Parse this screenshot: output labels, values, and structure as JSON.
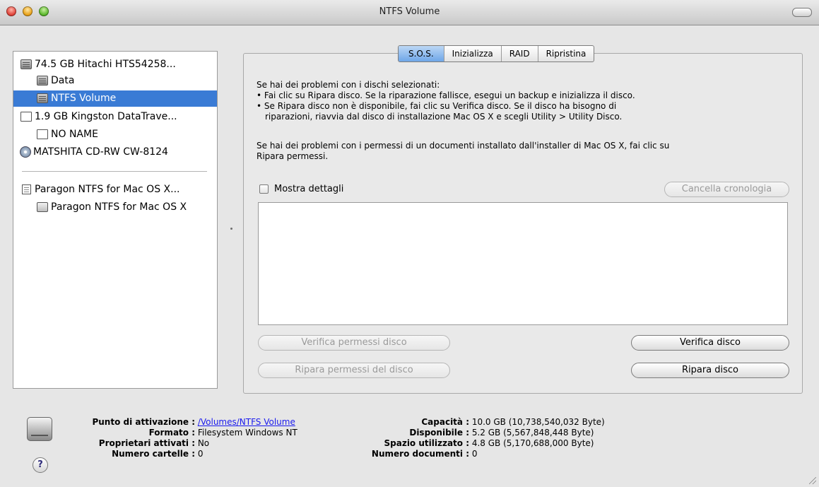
{
  "window": {
    "title": "NTFS Volume"
  },
  "sidebar": {
    "items": [
      {
        "label": "74.5 GB Hitachi HTS54258...",
        "icon": "hard-disk-icon"
      },
      {
        "label": "Data",
        "icon": "volume-icon"
      },
      {
        "label": "NTFS Volume",
        "icon": "volume-icon",
        "selected": true
      },
      {
        "label": "1.9 GB Kingston DataTrave...",
        "icon": "usb-drive-icon"
      },
      {
        "label": "NO NAME",
        "icon": "usb-volume-icon"
      },
      {
        "label": "MATSHITA CD-RW CW-8124",
        "icon": "optical-disc-icon"
      },
      {
        "label": "Paragon NTFS for Mac OS X...",
        "icon": "disk-image-icon"
      },
      {
        "label": "Paragon NTFS for Mac OS X",
        "icon": "mounted-image-icon"
      }
    ]
  },
  "tabs": [
    {
      "label": "S.O.S.",
      "active": true
    },
    {
      "label": "Inizializza"
    },
    {
      "label": "RAID"
    },
    {
      "label": "Ripristina"
    }
  ],
  "sos": {
    "intro": "Se hai dei problemi con i dischi selezionati:",
    "bullet1": "• Fai clic su Ripara disco. Se la riparazione fallisce, esegui un backup e inizializza il disco.",
    "bullet2a": "• Se Ripara disco non è disponibile, fai clic su Verifica disco. Se il disco ha bisogno di",
    "bullet2b": "riparazioni, riavvia dal disco di installazione Mac OS X e scegli Utility > Utility Disco.",
    "perm_a": "Se hai dei problemi con i permessi di un documenti installato dall'installer di Mac OS X, fai clic su",
    "perm_b": "Ripara permessi.",
    "show_details": "Mostra dettagli",
    "clear_history": "Cancella cronologia",
    "verify_permissions": "Verifica permessi disco",
    "repair_permissions": "Ripara permessi del disco",
    "verify_disk": "Verifica disco",
    "repair_disk": "Ripara disco"
  },
  "info": {
    "mount_point_key": "Punto di attivazione :",
    "mount_point_val": "/Volumes/NTFS Volume",
    "format_key": "Formato :",
    "format_val": "Filesystem Windows NT",
    "owners_key": "Proprietari attivati :",
    "owners_val": "No",
    "folders_key": "Numero cartelle :",
    "folders_val": "0",
    "capacity_key": "Capacità :",
    "capacity_val": "10.0 GB (10,738,540,032 Byte)",
    "available_key": "Disponibile :",
    "available_val": "5.2 GB (5,567,848,448 Byte)",
    "used_key": "Spazio utilizzato :",
    "used_val": "4.8 GB (5,170,688,000 Byte)",
    "documents_key": "Numero documenti :",
    "documents_val": "0"
  },
  "help_label": "?"
}
